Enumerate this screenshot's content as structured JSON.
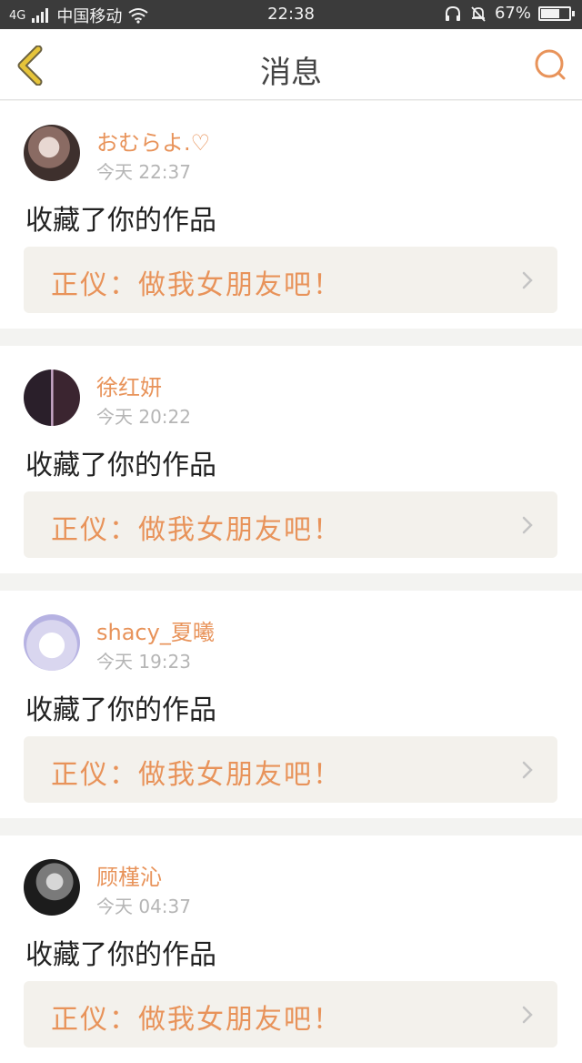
{
  "status_bar": {
    "network": "4G",
    "carrier": "中国移动",
    "time": "22:38",
    "battery": "67%",
    "battery_level": 0.67
  },
  "header": {
    "title": "消息",
    "back_icon": "chevron-left-icon",
    "search_icon": "search-icon"
  },
  "colors": {
    "accent": "#e8935a",
    "back_icon": "#e6c43a",
    "quote_bg": "#f3f1ec"
  },
  "messages": [
    {
      "username": "おむらよ.♡",
      "time": "今天 22:37",
      "action": "收藏了你的作品",
      "work_label": "正仪：",
      "work_title": "做我女朋友吧！"
    },
    {
      "username": "徐红妍",
      "time": "今天 20:22",
      "action": "收藏了你的作品",
      "work_label": "正仪：",
      "work_title": "做我女朋友吧！"
    },
    {
      "username": "shacy_夏曦",
      "time": "今天 19:23",
      "action": "收藏了你的作品",
      "work_label": "正仪：",
      "work_title": "做我女朋友吧！"
    },
    {
      "username": "顾槿沁",
      "time": "今天 04:37",
      "action": "收藏了你的作品",
      "work_label": "正仪：",
      "work_title": "做我女朋友吧！"
    }
  ]
}
